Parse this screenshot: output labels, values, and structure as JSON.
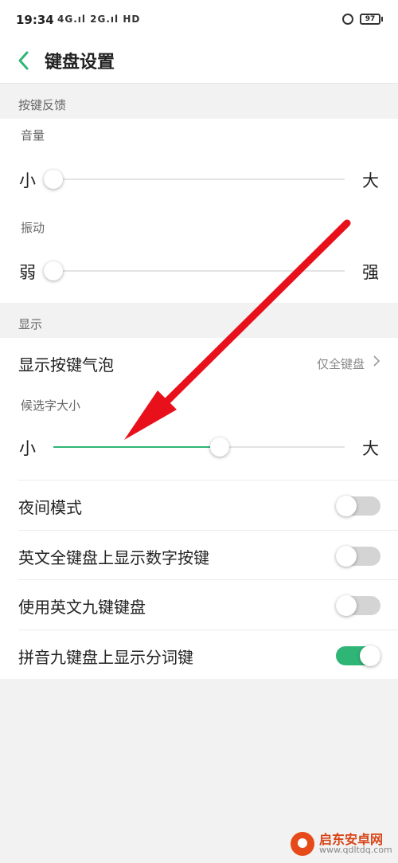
{
  "status_bar": {
    "time": "19:34",
    "signal": "4G.ıl 2G.ıl HD",
    "battery": "97"
  },
  "header": {
    "title": "键盘设置"
  },
  "key_feedback": {
    "section_title": "按键反馈",
    "volume": {
      "label": "音量",
      "min_label": "小",
      "max_label": "大",
      "level": 0
    },
    "vibration": {
      "label": "振动",
      "min_label": "弱",
      "max_label": "强",
      "level": 0
    }
  },
  "display": {
    "section_title": "显示",
    "show_key_bubble": {
      "label": "显示按键气泡",
      "value": "仅全键盘"
    },
    "candidate_size": {
      "label": "候选字大小",
      "min_label": "小",
      "max_label": "大",
      "level": 0.57
    },
    "toggles": [
      {
        "label": "夜间模式",
        "on": false
      },
      {
        "label": "英文全键盘上显示数字按键",
        "on": false
      },
      {
        "label": "使用英文九键键盘",
        "on": false
      },
      {
        "label": "拼音九键盘上显示分词键",
        "on": true
      }
    ]
  },
  "watermark": {
    "title": "启东安卓网",
    "url": "www.qdltdq.com"
  },
  "colors": {
    "accent": "#2fb677",
    "arrow": "#e8101a"
  },
  "icons": {
    "back": "chevron-left-icon",
    "more": "chevron-right-icon"
  }
}
